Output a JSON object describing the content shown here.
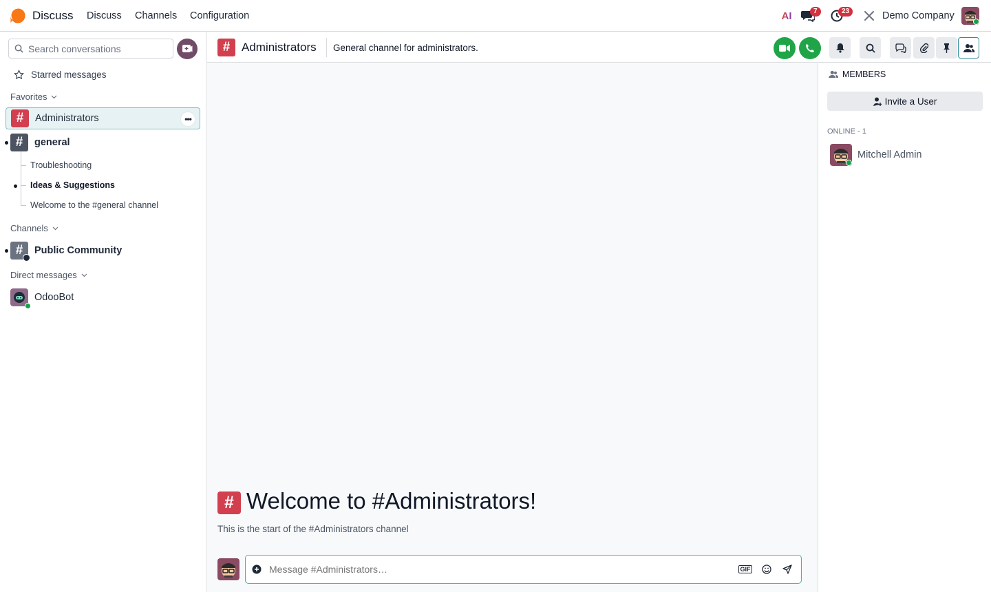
{
  "navbar": {
    "app_title": "Discuss",
    "menu": [
      "Discuss",
      "Channels",
      "Configuration"
    ],
    "ai_label": "AI",
    "messages_badge": "7",
    "activities_badge": "23",
    "company": "Demo Company"
  },
  "sidebar": {
    "search_placeholder": "Search conversations",
    "starred": "Starred messages",
    "favorites_header": "Favorites",
    "favorites": [
      {
        "label": "Administrators",
        "color": "#d23f4f",
        "active": true
      },
      {
        "label": "general",
        "color": "#4c5461",
        "unread": true
      }
    ],
    "threads": [
      "Troubleshooting",
      "Ideas & Suggestions",
      "Welcome to the #general channel"
    ],
    "channels_header": "Channels",
    "channels": [
      {
        "label": "Public Community",
        "color": "#6b7280",
        "unread": true
      }
    ],
    "dm_header": "Direct messages",
    "dms": [
      {
        "label": "OdooBot"
      }
    ]
  },
  "header": {
    "channel_name": "Administrators",
    "description": "General channel for administrators."
  },
  "chat": {
    "welcome_title": "Welcome to #Administrators!",
    "welcome_sub": "This is the start of the #Administrators channel",
    "composer_placeholder": "Message #Administrators…",
    "gif_label": "GIF"
  },
  "members": {
    "title": "MEMBERS",
    "invite": "Invite a User",
    "online_label": "ONLINE - 1",
    "list": [
      {
        "name": "Mitchell Admin"
      }
    ]
  },
  "colors": {
    "brand": "#714b67",
    "accent": "#2f8f98",
    "danger": "#d23f4f",
    "success": "#1fa547"
  }
}
